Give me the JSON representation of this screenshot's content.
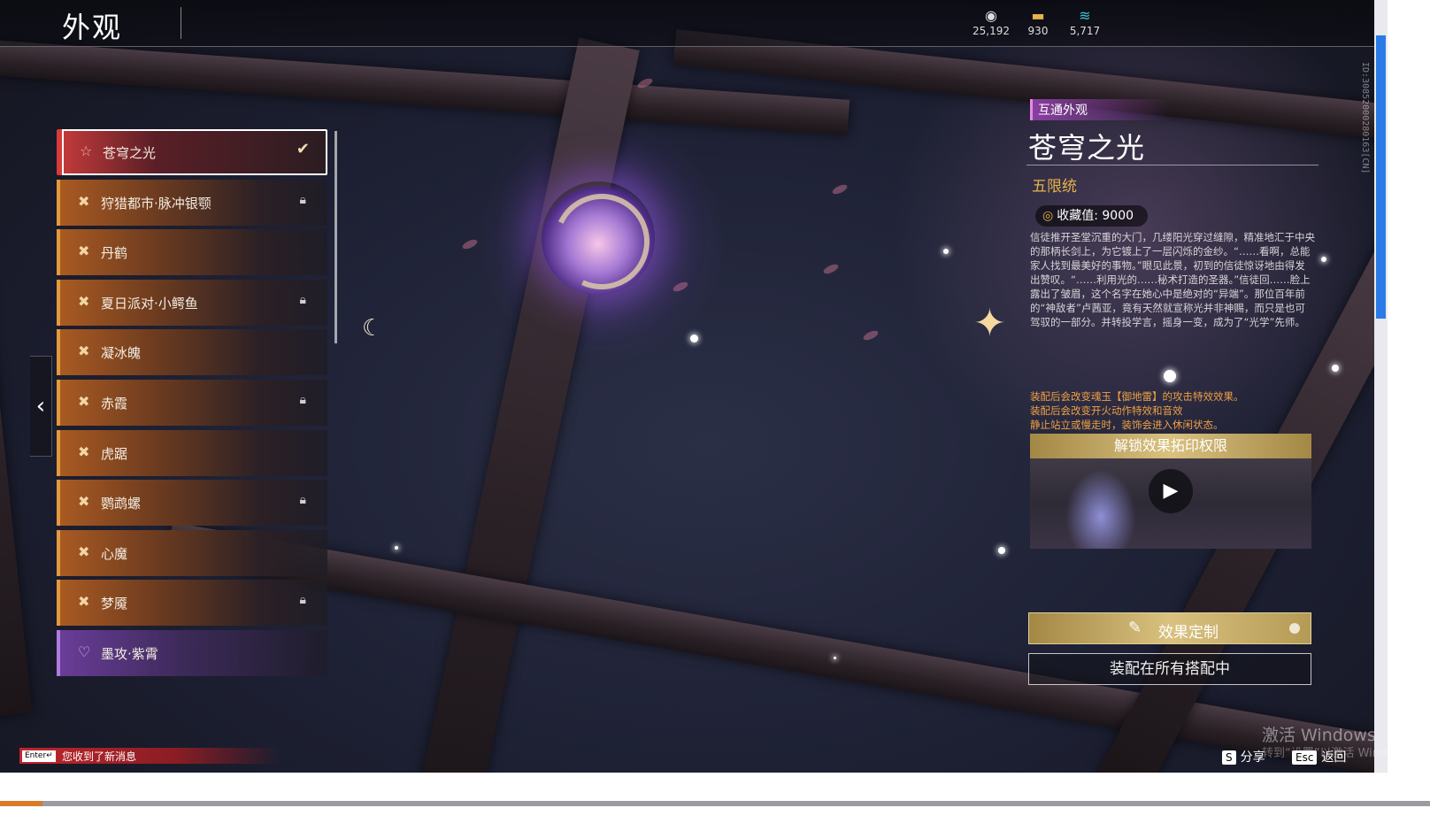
{
  "header": {
    "title": "外观",
    "currencies": [
      {
        "icon": "silver-coin-icon",
        "value": "25,192"
      },
      {
        "icon": "gold-bar-icon",
        "value": "930"
      },
      {
        "icon": "feather-icon",
        "value": "5,717"
      }
    ]
  },
  "skins": [
    {
      "name": "苍穹之光",
      "selected": true,
      "locked": false,
      "style": "red"
    },
    {
      "name": "狩猎都市·脉冲银颚",
      "selected": false,
      "locked": true,
      "style": "orange"
    },
    {
      "name": "丹鹤",
      "selected": false,
      "locked": false,
      "style": "orange"
    },
    {
      "name": "夏日派对·小鳄鱼",
      "selected": false,
      "locked": true,
      "style": "orange"
    },
    {
      "name": "凝冰魄",
      "selected": false,
      "locked": false,
      "style": "orange"
    },
    {
      "name": "赤霞",
      "selected": false,
      "locked": true,
      "style": "orange"
    },
    {
      "name": "虎踞",
      "selected": false,
      "locked": false,
      "style": "orange"
    },
    {
      "name": "鹦鹉螺",
      "selected": false,
      "locked": true,
      "style": "orange"
    },
    {
      "name": "心魔",
      "selected": false,
      "locked": false,
      "style": "orange"
    },
    {
      "name": "梦魇",
      "selected": false,
      "locked": true,
      "style": "orange"
    },
    {
      "name": "墨攻·紫霄",
      "selected": false,
      "locked": false,
      "style": "purple"
    }
  ],
  "detail": {
    "tag": "互通外观",
    "title": "苍穹之光",
    "rarity": "五限统",
    "collect_label": "收藏值: 9000",
    "description": "信徒推开圣堂沉重的大门，几缕阳光穿过缝隙，精准地汇于中央的那柄长剑上，为它镀上了一层闪烁的金纱。“……看啊，总能家人找到最美好的事物。”眼见此景，初到的信徒惊讶地由得发出赞叹。“……利用光的……秘术打造的圣器。”信徒回……脸上露出了皱眉，这个名字在她心中是绝对的“异端”。那位百年前的“神敌者”卢茜亚，竟有天然就宣称光并非神赐，而只是也可驾驭的一部分。并转投学言，摇身一变，成为了“光学”先师。",
    "effects": [
      "装配后会改变魂玉【御地雷】的攻击特效效果。",
      "装配后会改变开火动作特效和音效",
      "静止站立或慢走时，装饰会进入休闲状态。"
    ],
    "video_title": "解锁效果拓印权限",
    "customize_label": "效果定制",
    "equip_all_label": "装配在所有搭配中",
    "id_text": "ID:3085200028016​3[CN]"
  },
  "notification": {
    "key": "Enter↵",
    "message": "您收到了新消息"
  },
  "hotkeys": [
    {
      "key": "S",
      "label": "分享"
    },
    {
      "key": "Esc",
      "label": "返回"
    }
  ],
  "watermark": {
    "line1": "激活 Windows",
    "line2": "转到“设置”以激活 Windows。"
  }
}
